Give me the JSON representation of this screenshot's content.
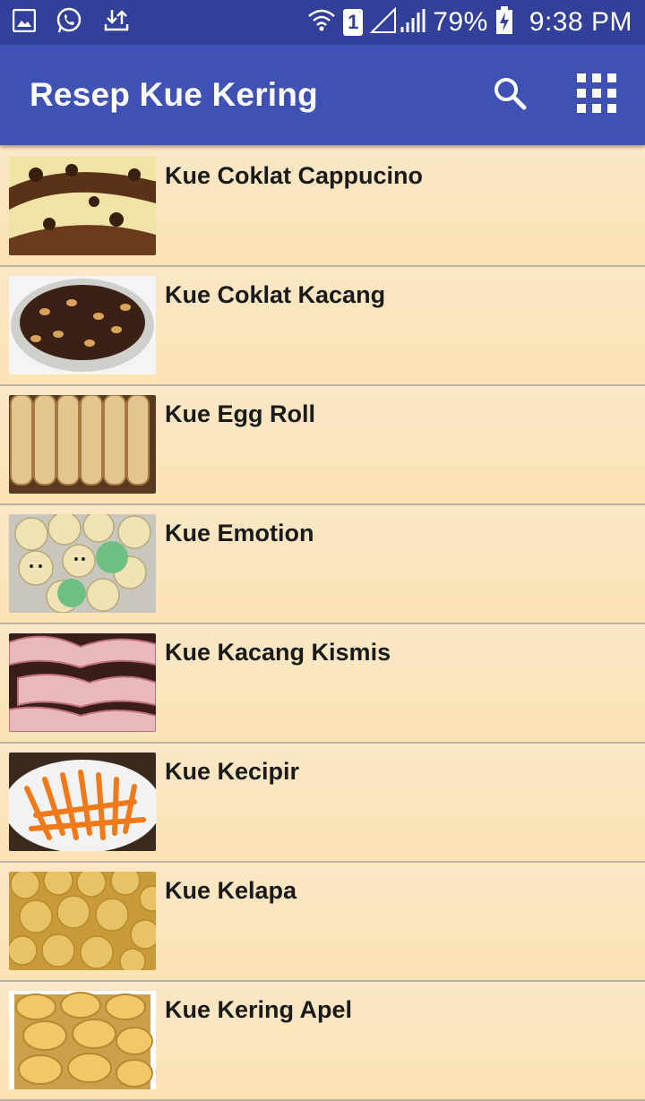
{
  "status_bar": {
    "battery": "79%",
    "time": "9:38 PM",
    "sim_label": "1",
    "icons": [
      "gallery-icon",
      "whatsapp-icon",
      "download-upload-icon",
      "wifi-icon",
      "sim-icon",
      "signal-icon",
      "battery-charging-icon"
    ]
  },
  "app_bar": {
    "title": "Resep Kue Kering",
    "actions": [
      "search-icon",
      "grid-menu-icon"
    ]
  },
  "colors": {
    "status_bar": "#32409a",
    "app_bar": "#3f51b5",
    "list_bg": "#fde3b4"
  },
  "recipes": [
    {
      "label": "Kue Coklat Cappucino"
    },
    {
      "label": "Kue Coklat Kacang"
    },
    {
      "label": "Kue Egg Roll"
    },
    {
      "label": "Kue Emotion"
    },
    {
      "label": "Kue Kacang Kismis"
    },
    {
      "label": "Kue Kecipir"
    },
    {
      "label": "Kue Kelapa"
    },
    {
      "label": "Kue Kering Apel"
    }
  ]
}
